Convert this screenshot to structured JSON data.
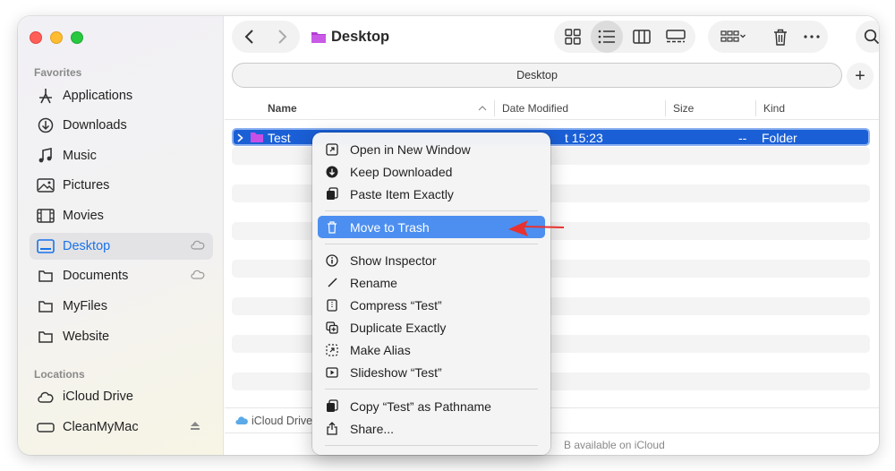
{
  "window": {
    "title": "Desktop"
  },
  "sidebar": {
    "favorites_heading": "Favorites",
    "favorites": [
      {
        "label": "Applications",
        "icon": "applications-icon"
      },
      {
        "label": "Downloads",
        "icon": "downloads-icon"
      },
      {
        "label": "Music",
        "icon": "music-icon"
      },
      {
        "label": "Pictures",
        "icon": "pictures-icon"
      },
      {
        "label": "Movies",
        "icon": "movies-icon"
      },
      {
        "label": "Desktop",
        "icon": "desktop-icon",
        "selected": true,
        "cloud": true
      },
      {
        "label": "Documents",
        "icon": "documents-icon",
        "cloud": true
      },
      {
        "label": "MyFiles",
        "icon": "folder-icon"
      },
      {
        "label": "Website",
        "icon": "folder-icon"
      }
    ],
    "locations_heading": "Locations",
    "locations": [
      {
        "label": "iCloud Drive",
        "icon": "icloud-icon"
      },
      {
        "label": "CleanMyMac",
        "icon": "drive-icon",
        "eject": true
      }
    ]
  },
  "pathbar": {
    "label": "Desktop"
  },
  "columns": {
    "name": "Name",
    "date": "Date Modified",
    "size": "Size",
    "kind": "Kind"
  },
  "selected_row": {
    "name": "Test",
    "date_fragment": "t 15:23",
    "size": "--",
    "kind": "Folder"
  },
  "status": {
    "left": "iCloud Drive",
    "right": "B available on iCloud"
  },
  "context_menu": {
    "group1": [
      "Open in New Window",
      "Keep Downloaded",
      "Paste Item Exactly"
    ],
    "highlighted": "Move to Trash",
    "group2": [
      "Show Inspector",
      "Rename",
      "Compress “Test”",
      "Duplicate Exactly",
      "Make Alias",
      "Slideshow “Test”"
    ],
    "group3": [
      "Copy “Test” as Pathname",
      "Share..."
    ]
  },
  "colors": {
    "accent": "#1a73e8",
    "selection": "#1a5fd6",
    "menu_highlight": "#4c8ff0",
    "arrow": "#e8322f",
    "folder": "#b43cd6"
  }
}
